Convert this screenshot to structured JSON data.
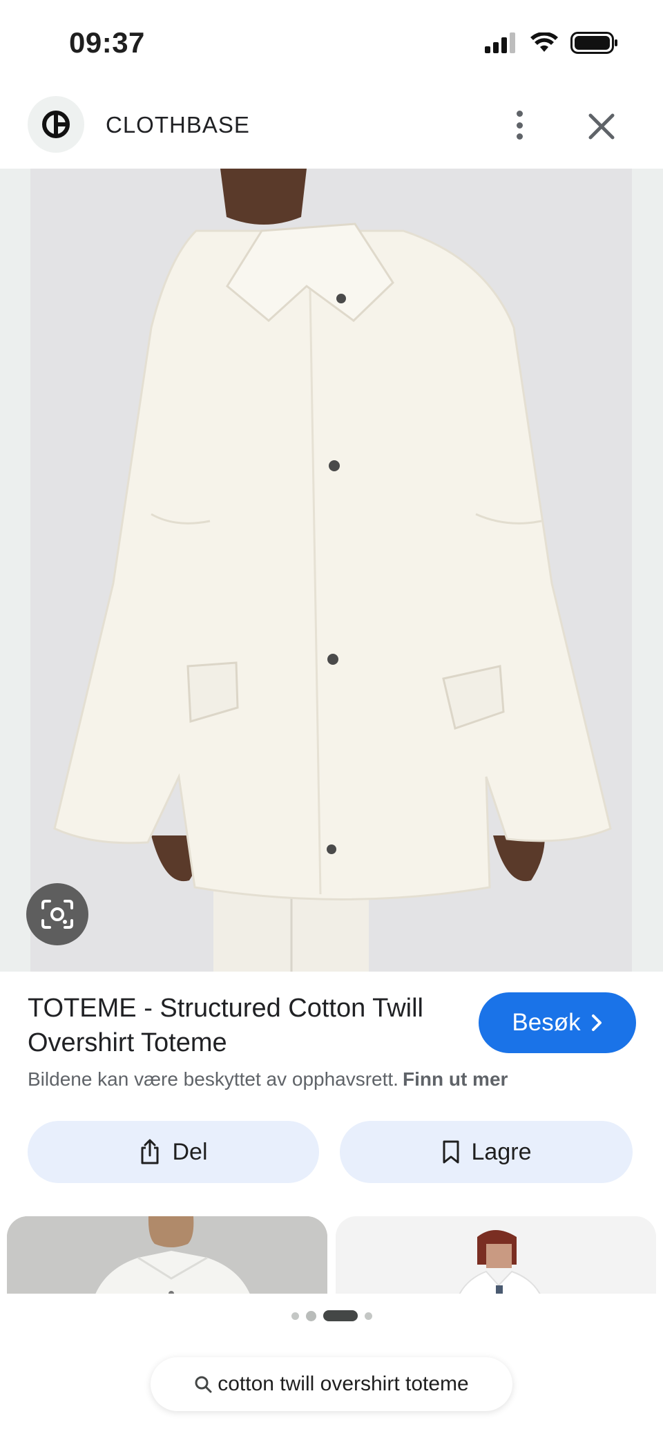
{
  "status_bar": {
    "time": "09:37",
    "icons": [
      "signal-icon",
      "wifi-icon",
      "battery-icon"
    ]
  },
  "header": {
    "site_name": "CLOTHBASE",
    "logo_icon": "clothbase-logo-icon",
    "menu_icon": "more-vert-icon",
    "close_icon": "close-icon"
  },
  "image": {
    "description_icon": "lens-icon"
  },
  "product": {
    "title": "TOTEME - Structured Cotton Twill Overshirt Toteme",
    "visit_label": "Besøk",
    "copyright_text": "Bildene kan være beskyttet av opphavsrett.",
    "learn_more": "Finn ut mer"
  },
  "actions": {
    "share_label": "Del",
    "save_label": "Lagre"
  },
  "pager": {
    "count": 4,
    "active_index": 2
  },
  "search": {
    "query": "cotton twill overshirt toteme"
  },
  "colors": {
    "accent": "#1a73e8",
    "action_bg": "#e8effc",
    "image_bg": "#e3e3e5",
    "garment": "#f6f3ea"
  }
}
